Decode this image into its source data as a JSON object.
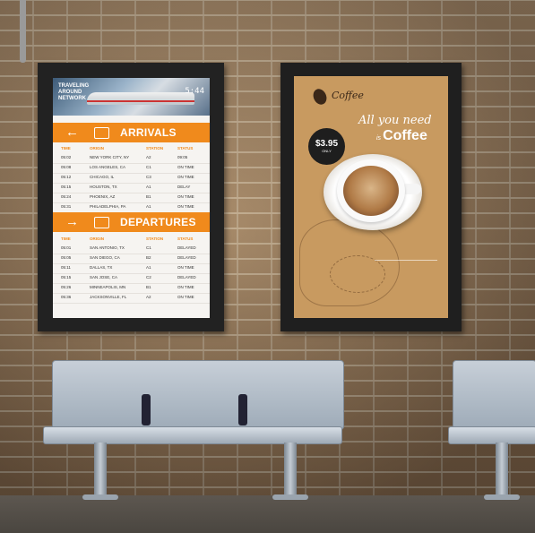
{
  "left_sign": {
    "header_lines": [
      "TRAVELING AROUND",
      "NETWORK"
    ],
    "clock": "5:44",
    "arrivals": {
      "title": "ARRIVALS",
      "columns": [
        "TIME",
        "ORIGIN",
        "STATION",
        "STATUS"
      ],
      "rows": [
        [
          "05:02",
          "NEW YORK CITY, NY",
          "A2",
          "09:05"
        ],
        [
          "05:08",
          "LOS ANGELES, CA",
          "C1",
          "ON TIME"
        ],
        [
          "05:12",
          "CHICAGO, IL",
          "C3",
          "ON TIME"
        ],
        [
          "05:15",
          "HOUSTON, TX",
          "A1",
          "DELAY"
        ],
        [
          "05:24",
          "PHOENIX, AZ",
          "B1",
          "ON TIME"
        ],
        [
          "05:31",
          "PHILADELPHIA, PA",
          "A1",
          "ON TIME"
        ]
      ]
    },
    "departures": {
      "title": "DEPARTURES",
      "columns": [
        "TIME",
        "ORIGIN",
        "STATION",
        "STATUS"
      ],
      "rows": [
        [
          "05:01",
          "SAN ANTONIO, TX",
          "C1",
          "DELAYED"
        ],
        [
          "05:05",
          "SAN DIEGO, CA",
          "B2",
          "DELAYED"
        ],
        [
          "05:11",
          "DALLAS, TX",
          "A1",
          "ON TIME"
        ],
        [
          "05:15",
          "SAN JOSE, CA",
          "C2",
          "DELAYED"
        ],
        [
          "05:26",
          "MINNEAPOLIS, MN",
          "B1",
          "ON TIME"
        ],
        [
          "05:36",
          "JACKSONVILLE, FL",
          "A2",
          "ON TIME"
        ]
      ]
    }
  },
  "right_sign": {
    "brand": "Coffee",
    "tagline": "All you need",
    "tagline2_prefix": "is",
    "tagline2": "Coffee",
    "price": "$3.95",
    "price_unit": "ONLY"
  }
}
